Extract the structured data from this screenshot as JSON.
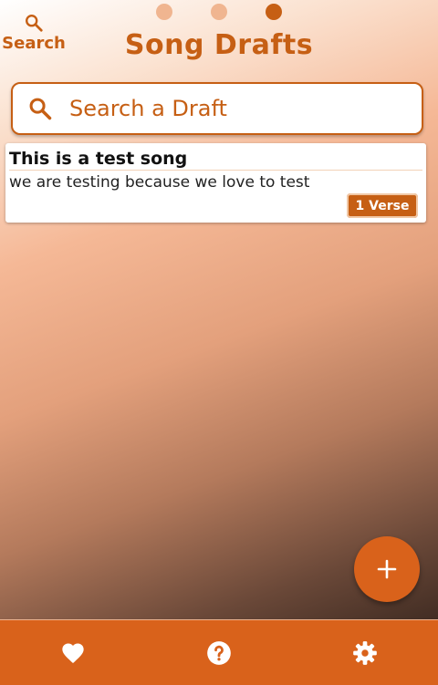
{
  "header": {
    "search_label": "Search",
    "title": "Song Drafts",
    "page_indicator": {
      "count": 3,
      "active_index": 2
    }
  },
  "search": {
    "placeholder": "Search a Draft",
    "value": ""
  },
  "drafts": [
    {
      "title": "This is a test song",
      "subtitle": "we are testing because we love to test",
      "verse_badge": "1 Verse"
    }
  ],
  "fab": {
    "icon": "plus-icon"
  },
  "bottom_nav": {
    "items": [
      {
        "icon": "heart-icon"
      },
      {
        "icon": "help-icon"
      },
      {
        "icon": "gear-icon"
      }
    ]
  },
  "colors": {
    "accent": "#c65f14",
    "nav_background": "#d9621b",
    "dot_inactive": "#f0b590"
  }
}
